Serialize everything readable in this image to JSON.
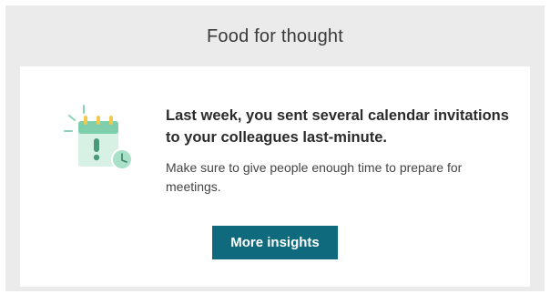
{
  "header": {
    "title": "Food for thought"
  },
  "card": {
    "headline": "Last week, you sent several calendar invitations to your colleagues last-minute.",
    "body": "Make sure to give people enough time to prepare for meetings.",
    "button_label": "More insights",
    "illustration_icon": "calendar-alert-clock-icon"
  },
  "colors": {
    "frame_background": "#ebebeb",
    "card_background": "#ffffff",
    "button_background": "#0f6a7d",
    "button_text": "#ffffff",
    "illustration_green": "#7fcfad",
    "illustration_yellow": "#f2c94c"
  }
}
